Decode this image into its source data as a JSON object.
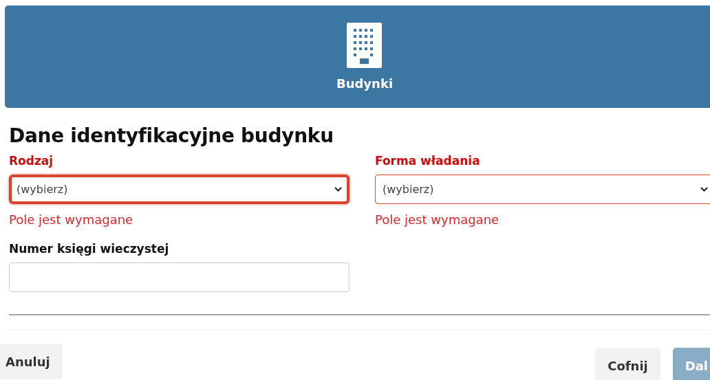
{
  "header": {
    "title": "Budynki"
  },
  "form": {
    "title": "Dane identyfikacyjne budynku",
    "fields": [
      {
        "kind": "select",
        "label": "Rodzaj",
        "value": "(wybierz)",
        "invalid": true,
        "focused": true,
        "error": "Pole jest wymagane"
      },
      {
        "kind": "select",
        "label": "Forma władania",
        "value": "(wybierz)",
        "invalid": true,
        "focused": false,
        "error": "Pole jest wymagane"
      },
      {
        "kind": "text",
        "label": "Numer księgi wieczystej",
        "invalid": false,
        "focused": false
      }
    ]
  },
  "footer": {
    "left_buttons": [
      {
        "label": "Anuluj",
        "disabled": false
      }
    ],
    "right_buttons": [
      {
        "label": "Cofnij",
        "disabled": false,
        "kind": "secondary"
      },
      {
        "label": "Dal",
        "disabled": true,
        "kind": "primary"
      }
    ]
  }
}
